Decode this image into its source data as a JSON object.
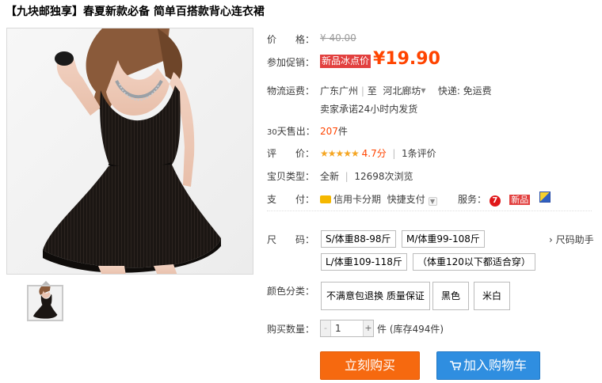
{
  "title": "【九块邮独享】春夏新款必备 简单百搭款背心连衣裙",
  "price": {
    "label": "价　　格：",
    "original": "¥ 40.00"
  },
  "promo": {
    "label": "参加促销：",
    "tag": "新品冰点价",
    "currency": "¥",
    "amount": "19.90"
  },
  "shipping": {
    "label": "物流运费：",
    "from": "广东广州",
    "sep": "|",
    "to_prefix": "至",
    "to": "河北廊坊",
    "express": "快递: 免运费",
    "promise": "卖家承诺24小时内发货"
  },
  "sales": {
    "label_prefix": "30",
    "label": "天售出：",
    "count": "207",
    "unit": "件"
  },
  "rating": {
    "label": "评　　价：",
    "stars": "★★★★★",
    "score": "4.7分",
    "sep": "|",
    "reviews": "1条评价"
  },
  "item_type": {
    "label": "宝贝类型：",
    "condition": "全新",
    "sep": "|",
    "views": "12698次浏览"
  },
  "payment": {
    "label": "支　　付：",
    "installment": "信用卡分期",
    "quick_pay": "快捷支付",
    "service_label": "服务：",
    "service_new": "新品",
    "service_tmall_glyph": "7"
  },
  "size": {
    "label": "尺　　码：",
    "options": [
      "S/体重88-98斤",
      "M/体重99-108斤",
      "L/体重109-118斤",
      "（体重120以下都适合穿）"
    ],
    "helper": "› 尺码助手"
  },
  "color": {
    "label": "颜色分类：",
    "options": [
      "不满意包退换 质量保证",
      "黑色",
      "米白"
    ]
  },
  "quantity": {
    "label": "购买数量：",
    "minus": "-",
    "plus": "+",
    "value": "1",
    "stock": "件 (库存494件)"
  },
  "buttons": {
    "buy": "立刻购买",
    "cart": "加入购物车"
  },
  "colors": {
    "price_orange": "#ff4400",
    "promo_red": "#e2403f",
    "buy_orange": "#f6690f",
    "cart_blue": "#2f8ee0",
    "star_gold": "#f5a623"
  },
  "icons": {
    "card": "credit-card-icon",
    "tmall": "tmall-service-icon",
    "check": "guarantee-icon",
    "cart": "cart-icon"
  }
}
